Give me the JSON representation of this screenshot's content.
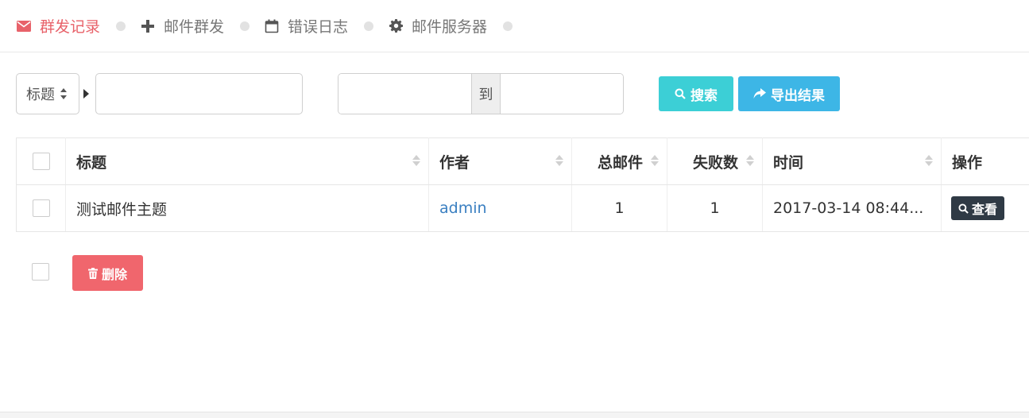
{
  "nav": {
    "items": [
      {
        "label": "群发记录",
        "icon": "envelope-icon",
        "active": true
      },
      {
        "label": "邮件群发",
        "icon": "plus-icon",
        "active": false
      },
      {
        "label": "错误日志",
        "icon": "calendar-icon",
        "active": false
      },
      {
        "label": "邮件服务器",
        "icon": "gear-icon",
        "active": false
      }
    ],
    "active_color": "#e8626a"
  },
  "search": {
    "field_select": "标题",
    "keyword_value": "",
    "range_from": "",
    "range_to_label": "到",
    "range_to": "",
    "search_label": "搜索",
    "export_label": "导出结果"
  },
  "table": {
    "headers": {
      "title": "标题",
      "author": "作者",
      "total": "总邮件",
      "failed": "失败数",
      "time": "时间",
      "action": "操作"
    },
    "rows": [
      {
        "title": "测试邮件主题",
        "author": "admin",
        "total": "1",
        "failed": "1",
        "time": "2017-03-14 08:44...",
        "action": "查看"
      }
    ]
  },
  "bulk": {
    "delete_label": "删除"
  },
  "colors": {
    "search_btn": "#3ccfd6",
    "export_btn": "#3db6e6",
    "delete_btn": "#f0666d",
    "view_btn": "#2f3a45",
    "time_text": "#e8392f",
    "link": "#3a7fc1"
  }
}
